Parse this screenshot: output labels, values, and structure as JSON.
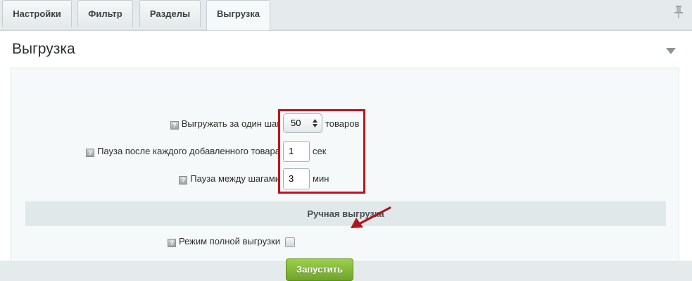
{
  "tabs": [
    {
      "label": "Настройки"
    },
    {
      "label": "Фильтр"
    },
    {
      "label": "Разделы"
    },
    {
      "label": "Выгрузка"
    }
  ],
  "section": {
    "title": "Выгрузка"
  },
  "fields": {
    "step_size": {
      "label": "Выгружать за один шаг",
      "value": "50",
      "unit": "товаров"
    },
    "pause_after_item": {
      "label": "Пауза после каждого добавленного товара",
      "value": "1",
      "unit": "сек"
    },
    "pause_between_steps": {
      "label": "Пауза между шагами",
      "value": "3",
      "unit": "мин"
    }
  },
  "manual": {
    "header": "Ручная выгрузка",
    "full_mode_label": "Режим полной выгрузки",
    "run_button": "Запустить"
  },
  "colors": {
    "highlight": "#c1121d",
    "button": "#7fb635"
  }
}
